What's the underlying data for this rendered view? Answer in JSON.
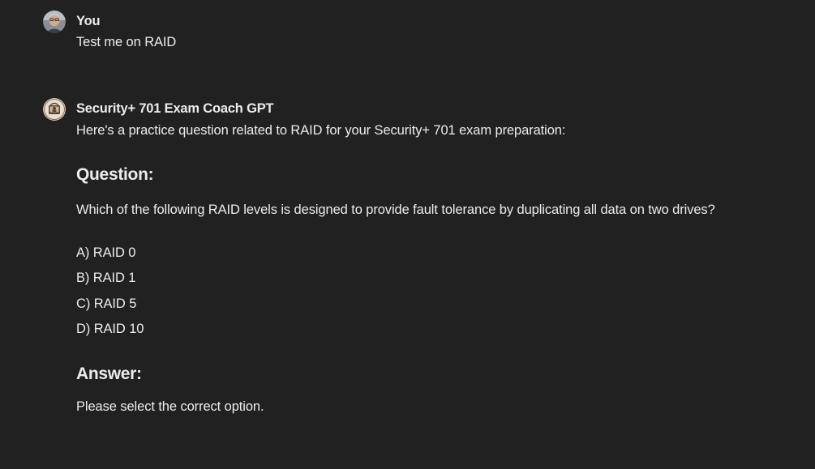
{
  "conversation": {
    "user_message": {
      "author": "You",
      "text": "Test me on RAID"
    },
    "assistant_message": {
      "author": "Security+ 701 Exam Coach GPT",
      "intro": "Here's a practice question related to RAID for your Security+ 701 exam preparation:",
      "question_heading": "Question:",
      "question_text": "Which of the following RAID levels is designed to provide fault tolerance by duplicating all data on two drives?",
      "options": [
        "A) RAID 0",
        "B) RAID 1",
        "C) RAID 5",
        "D) RAID 10"
      ],
      "answer_heading": "Answer:",
      "answer_text": "Please select the correct option."
    }
  },
  "icons": {
    "user_avatar": "user-photo-avatar",
    "assistant_avatar": "gpt-avatar"
  }
}
